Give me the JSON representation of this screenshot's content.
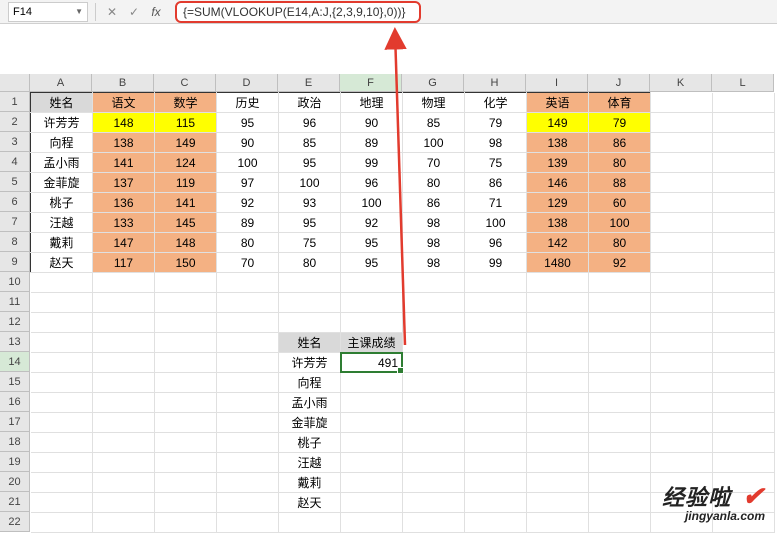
{
  "cell_ref": "F14",
  "formula": "{=SUM(VLOOKUP(E14,A:J,{2,3,9,10},0))}",
  "columns": [
    "A",
    "B",
    "C",
    "D",
    "E",
    "F",
    "G",
    "H",
    "I",
    "J",
    "K",
    "L"
  ],
  "rows": [
    "1",
    "2",
    "3",
    "4",
    "5",
    "6",
    "7",
    "8",
    "9",
    "10",
    "11",
    "12",
    "13",
    "14",
    "15",
    "16",
    "17",
    "18",
    "19",
    "20",
    "21",
    "22"
  ],
  "top": {
    "headers": [
      "姓名",
      "语文",
      "数学",
      "历史",
      "政治",
      "地理",
      "物理",
      "化学",
      "英语",
      "体育"
    ],
    "body": [
      [
        "许芳芳",
        "148",
        "115",
        "95",
        "96",
        "90",
        "85",
        "79",
        "149",
        "79"
      ],
      [
        "向程",
        "138",
        "149",
        "90",
        "85",
        "89",
        "100",
        "98",
        "138",
        "86"
      ],
      [
        "孟小雨",
        "141",
        "124",
        "100",
        "95",
        "99",
        "70",
        "75",
        "139",
        "80"
      ],
      [
        "金菲旋",
        "137",
        "119",
        "97",
        "100",
        "96",
        "80",
        "86",
        "146",
        "88"
      ],
      [
        "桃子",
        "136",
        "141",
        "92",
        "93",
        "100",
        "86",
        "71",
        "129",
        "60"
      ],
      [
        "汪越",
        "133",
        "145",
        "89",
        "95",
        "92",
        "98",
        "100",
        "138",
        "100"
      ],
      [
        "戴莉",
        "147",
        "148",
        "80",
        "75",
        "95",
        "98",
        "96",
        "142",
        "80"
      ],
      [
        "赵天",
        "117",
        "150",
        "70",
        "80",
        "95",
        "98",
        "99",
        "1480",
        "92"
      ]
    ],
    "yellow_cells": [
      [
        0,
        1
      ],
      [
        0,
        2
      ],
      [
        0,
        8
      ],
      [
        0,
        9
      ]
    ]
  },
  "bottom": {
    "headers": [
      "姓名",
      "主课成绩"
    ],
    "rows": [
      [
        "许芳芳",
        "491"
      ],
      [
        "向程",
        ""
      ],
      [
        "孟小雨",
        ""
      ],
      [
        "金菲旋",
        ""
      ],
      [
        "桃子",
        ""
      ],
      [
        "汪越",
        ""
      ],
      [
        "戴莉",
        ""
      ],
      [
        "赵天",
        ""
      ]
    ]
  },
  "watermark": {
    "main": "经验啦",
    "sub": "jingyanla.com"
  },
  "chart_data": {
    "type": "table",
    "title": "成绩表",
    "headers": [
      "姓名",
      "语文",
      "数学",
      "历史",
      "政治",
      "地理",
      "物理",
      "化学",
      "英语",
      "体育"
    ],
    "rows": [
      [
        "许芳芳",
        148,
        115,
        95,
        96,
        90,
        85,
        79,
        149,
        79
      ],
      [
        "向程",
        138,
        149,
        90,
        85,
        89,
        100,
        98,
        138,
        86
      ],
      [
        "孟小雨",
        141,
        124,
        100,
        95,
        99,
        70,
        75,
        139,
        80
      ],
      [
        "金菲旋",
        137,
        119,
        97,
        100,
        96,
        80,
        86,
        146,
        88
      ],
      [
        "桃子",
        136,
        141,
        92,
        93,
        100,
        86,
        71,
        129,
        60
      ],
      [
        "汪越",
        133,
        145,
        89,
        95,
        92,
        98,
        100,
        138,
        100
      ],
      [
        "戴莉",
        147,
        148,
        80,
        75,
        95,
        98,
        96,
        142,
        80
      ],
      [
        "赵天",
        117,
        150,
        70,
        80,
        95,
        98,
        99,
        1480,
        92
      ]
    ]
  }
}
